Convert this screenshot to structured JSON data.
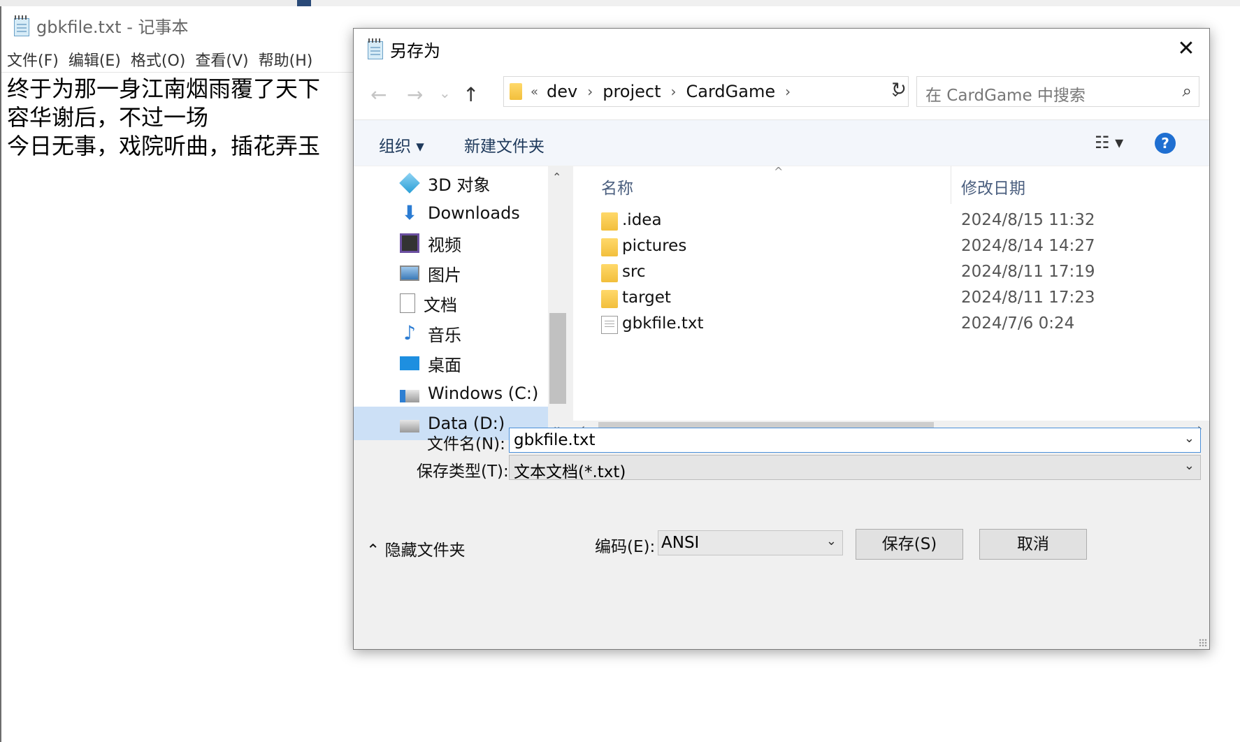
{
  "notepad": {
    "title": "gbkfile.txt - 记事本",
    "menu": [
      "文件(F)",
      "编辑(E)",
      "格式(O)",
      "查看(V)",
      "帮助(H)"
    ],
    "lines": [
      "终于为那一身江南烟雨覆了天下",
      "容华谢后，不过一场",
      "今日无事，戏院听曲，插花弄玉"
    ]
  },
  "dialog": {
    "title": "另存为",
    "close_glyph": "✕",
    "nav": {
      "back": "←",
      "forward": "→",
      "recent": "⌄",
      "up": "↑"
    },
    "address": {
      "overflow": "«",
      "crumbs": [
        "dev",
        "project",
        "CardGame"
      ],
      "sep": "›",
      "dropdown": "⌄"
    },
    "refresh": "↻",
    "search": {
      "placeholder": "在 CardGame 中搜索",
      "icon": "⌕"
    },
    "toolbar": {
      "organize": "组织 ▾",
      "new_folder": "新建文件夹",
      "view": "☷ ▾",
      "help": "?"
    },
    "nav_pane": [
      {
        "label": "3D 对象",
        "icon": "cube-3d-icon"
      },
      {
        "label": "Downloads",
        "icon": "download-icon"
      },
      {
        "label": "视频",
        "icon": "video-icon"
      },
      {
        "label": "图片",
        "icon": "pictures-icon"
      },
      {
        "label": "文档",
        "icon": "document-icon"
      },
      {
        "label": "音乐",
        "icon": "music-icon"
      },
      {
        "label": "桌面",
        "icon": "desktop-icon"
      },
      {
        "label": "Windows (C:)",
        "icon": "drive-c-icon"
      },
      {
        "label": "Data (D:)",
        "icon": "drive-d-icon",
        "selected": true
      }
    ],
    "columns": {
      "name": "名称",
      "modified": "修改日期",
      "sort_indicator": "^"
    },
    "files": [
      {
        "name": ".idea",
        "date": "2024/8/15 11:32",
        "kind": "folder"
      },
      {
        "name": "pictures",
        "date": "2024/8/14 14:27",
        "kind": "folder"
      },
      {
        "name": "src",
        "date": "2024/8/11 17:19",
        "kind": "folder"
      },
      {
        "name": "target",
        "date": "2024/8/11 17:23",
        "kind": "folder"
      },
      {
        "name": "gbkfile.txt",
        "date": "2024/7/6 0:24",
        "kind": "text-file"
      }
    ],
    "scroll": {
      "up": "⌃",
      "down": "⌄",
      "left": "‹",
      "right": "›"
    },
    "form": {
      "filename_label": "文件名(N):",
      "filename_value": "gbkfile.txt",
      "type_label": "保存类型(T):",
      "type_value": "文本文档(*.txt)",
      "dropdown": "⌄",
      "hide_folders": "⌃ 隐藏文件夹",
      "encoding_label": "编码(E):",
      "encoding_value": "ANSI",
      "save": "保存(S)",
      "cancel": "取消"
    }
  }
}
